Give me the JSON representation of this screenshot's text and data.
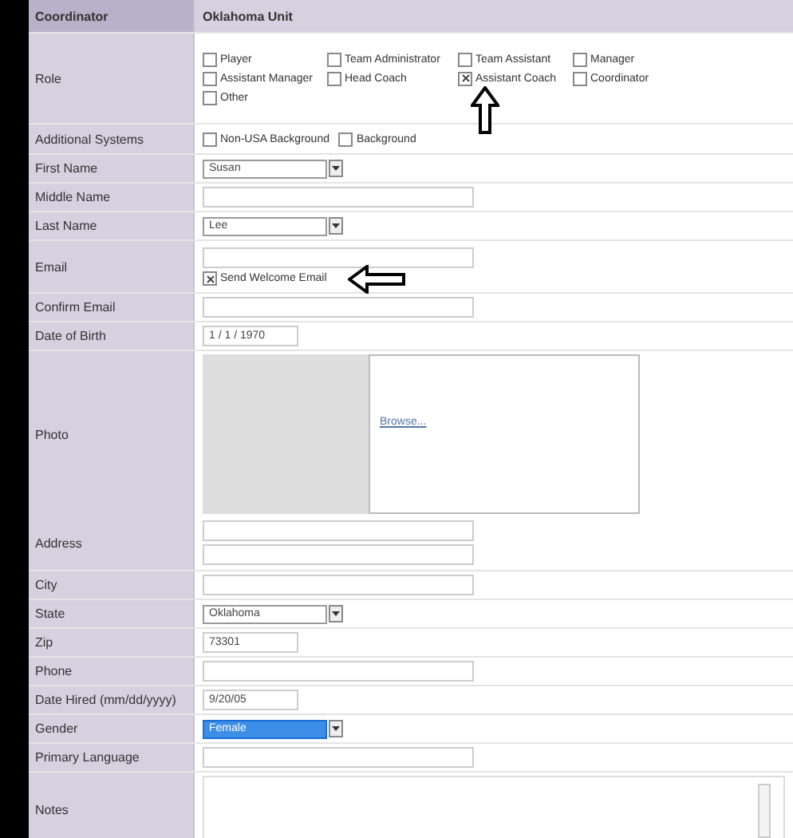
{
  "header": {
    "label": "Coordinator",
    "value": "Oklahoma Unit"
  },
  "rows": [
    {
      "kind": "checkboxes",
      "label": "Role",
      "options": [
        {
          "label": "Player",
          "checked": false
        },
        {
          "label": "Team Administrator",
          "checked": false
        },
        {
          "label": "Team Assistant",
          "checked": false
        },
        {
          "label": "Manager",
          "checked": false
        },
        {
          "label": "Assistant Manager",
          "checked": false
        },
        {
          "label": "Head Coach",
          "checked": false
        },
        {
          "label": "Assistant Coach",
          "checked": true
        },
        {
          "label": "Coordinator",
          "checked": false
        },
        {
          "label": "Other",
          "checked": false
        }
      ]
    },
    {
      "kind": "checkboxes",
      "label": "Additional Systems",
      "options": [
        {
          "label": "Non-USA Background",
          "checked": false
        },
        {
          "label": "Background",
          "checked": false
        }
      ]
    },
    {
      "kind": "select",
      "label": "First Name",
      "value": "Susan"
    },
    {
      "kind": "text",
      "label": "Middle Name"
    },
    {
      "kind": "select",
      "label": "Last Name",
      "value": "Lee"
    },
    {
      "kind": "email",
      "label": "Email",
      "option": {
        "label": "Send Welcome Email",
        "checked": true
      }
    },
    {
      "kind": "text",
      "label": "Confirm Email"
    },
    {
      "kind": "text",
      "label": "Date of Birth",
      "value": "1 / 1 / 1970"
    },
    {
      "kind": "photo",
      "label": "Photo",
      "link": "Browse..."
    },
    {
      "kind": "address",
      "label": "Address"
    },
    {
      "kind": "text",
      "label": "City"
    },
    {
      "kind": "select",
      "label": "State",
      "value": "Oklahoma"
    },
    {
      "kind": "text",
      "label": "Zip",
      "value": "73301"
    },
    {
      "kind": "text",
      "label": "Phone"
    },
    {
      "kind": "text",
      "label": "Date Hired (mm/dd/yyyy)",
      "value": "9/20/05"
    },
    {
      "kind": "select",
      "label": "Gender",
      "value": "Female",
      "selected": true
    },
    {
      "kind": "text",
      "label": "Primary Language"
    },
    {
      "kind": "textarea",
      "label": "Notes"
    }
  ]
}
